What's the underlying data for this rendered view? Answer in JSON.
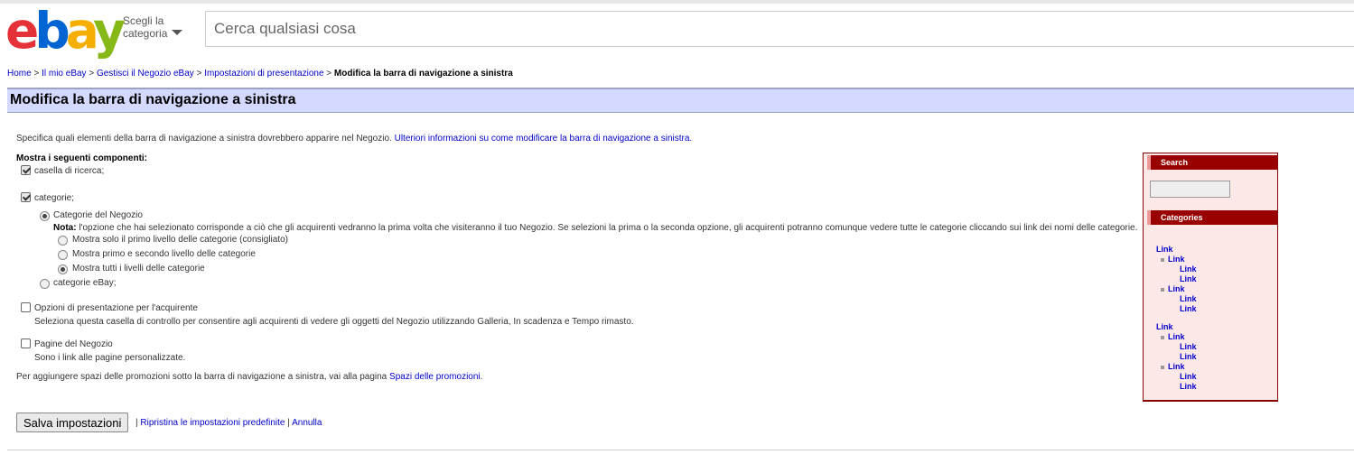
{
  "header": {
    "logo": [
      "e",
      "b",
      "a",
      "y"
    ],
    "category_select": "Scegli la categoria",
    "search_placeholder": "Cerca qualsiasi cosa"
  },
  "breadcrumb": [
    {
      "label": "Home",
      "link": true
    },
    {
      "label": "Il mio eBay",
      "link": true
    },
    {
      "label": "Gestisci il Negozio eBay",
      "link": true
    },
    {
      "label": "Impostazioni di presentazione",
      "link": true
    },
    {
      "label": "Modifica la barra di navigazione a sinistra",
      "link": false
    }
  ],
  "breadcrumb_sep": ">",
  "page_title": "Modifica la barra di navigazione a sinistra",
  "intro": {
    "text": "Specifica quali elementi della barra di navigazione a sinistra dovrebbero apparire nel Negozio.",
    "link": "Ulteriori informazioni su come modificare la barra di navigazione a sinistra."
  },
  "show_label": "Mostra i seguenti componenti:",
  "options": {
    "search_box": {
      "label": "casella di ricerca;",
      "checked": true
    },
    "categories": {
      "label": "categorie;",
      "checked": true
    },
    "store_categories": {
      "label": "Categorie del Negozio",
      "selected": true
    },
    "note_label": "Nota:",
    "note_text": "l'opzione che hai selezionato corrisponde a ciò che gli acquirenti vedranno la prima volta che visiteranno il tuo Negozio. Se selezioni la prima o la seconda opzione, gli acquirenti potranno comunque vedere tutte le categorie cliccando sui link dei nomi delle categorie.",
    "level_first": {
      "label": "Mostra solo il primo livello delle categorie (consigliato)",
      "selected": false
    },
    "level_second": {
      "label": "Mostra primo e secondo livello delle categorie",
      "selected": false
    },
    "level_all": {
      "label": "Mostra tutti i livelli delle categorie",
      "selected": true
    },
    "ebay_categories": {
      "label": "categorie eBay;",
      "selected": false
    },
    "buyer_options": {
      "label": "Opzioni di presentazione per l'acquirente",
      "checked": false,
      "desc": "Seleziona questa casella di controllo per consentire agli acquirenti di vedere gli oggetti del Negozio utilizzando Galleria, In scadenza e Tempo rimasto."
    },
    "store_pages": {
      "label": "Pagine del Negozio",
      "checked": false,
      "desc": "Sono i link alle pagine personalizzate."
    }
  },
  "promo": {
    "text": "Per aggiungere spazi delle promozioni sotto la barra di navigazione a sinistra, vai alla pagina",
    "link": "Spazi delle promozioni",
    "end": "."
  },
  "actions": {
    "save": "Salva impostazioni",
    "sep": "|",
    "reset": "Ripristina le impostazioni predefinite",
    "cancel": "Annulla"
  },
  "preview": {
    "search_title": "Search",
    "categories_title": "Categories",
    "link": "Link"
  }
}
